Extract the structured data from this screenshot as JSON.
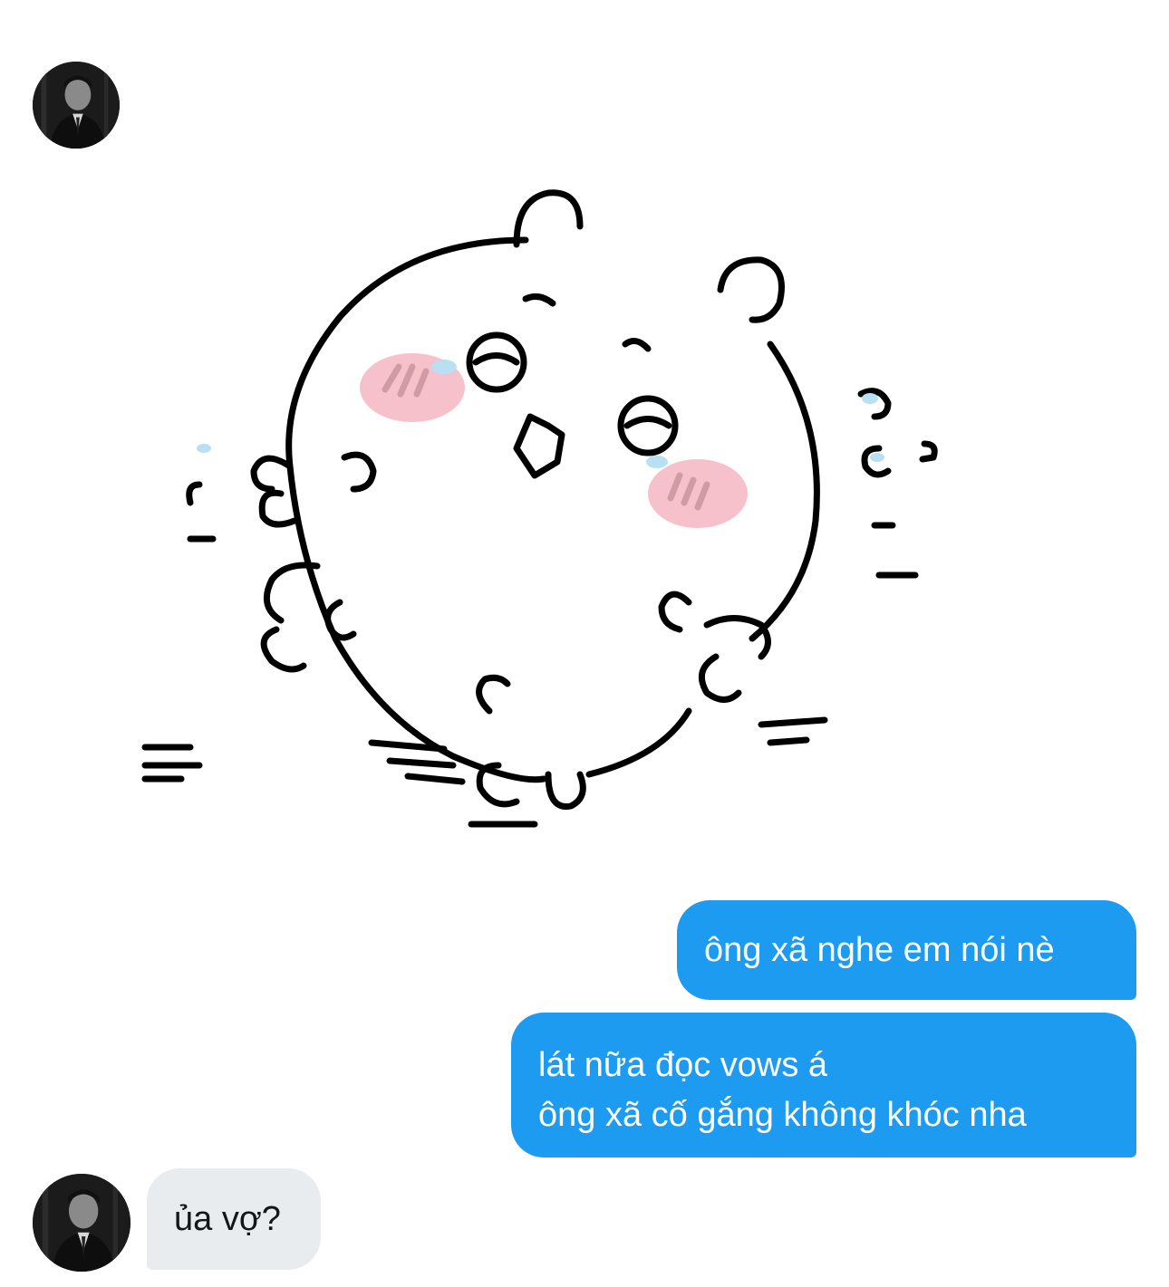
{
  "conversation": {
    "messages": [
      {
        "type": "sticker",
        "sender": "other",
        "icon": "crying-hamster-sticker"
      },
      {
        "type": "text",
        "sender": "me",
        "lines": [
          "ông xã nghe em nói nè"
        ]
      },
      {
        "type": "text",
        "sender": "me",
        "lines": [
          "lát nữa đọc vows á",
          "ông xã cố gắng không khóc nha"
        ]
      },
      {
        "type": "text",
        "sender": "other",
        "lines": [
          "ủa vợ?"
        ]
      }
    ]
  },
  "colors": {
    "outgoing_bubble": "#1d9bf0",
    "incoming_bubble": "#e9ecef",
    "background": "#ffffff"
  }
}
